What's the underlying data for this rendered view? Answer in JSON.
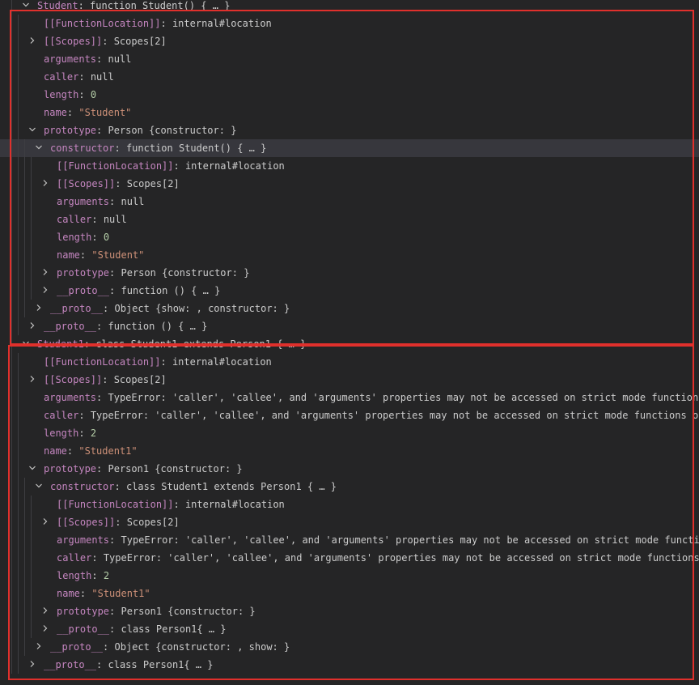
{
  "rows": [
    {
      "depth": 0,
      "expanded": true,
      "key": "Student",
      "val": "function Student() { … }",
      "kind": "fn"
    },
    {
      "depth": 1,
      "expanded": null,
      "key": "[[FunctionLocation]]",
      "val": "internal#location",
      "kind": "fn"
    },
    {
      "depth": 1,
      "expanded": false,
      "key": "[[Scopes]]",
      "val": "Scopes[2]",
      "kind": "fn"
    },
    {
      "depth": 1,
      "expanded": null,
      "key": "arguments",
      "val": "null",
      "kind": "fn"
    },
    {
      "depth": 1,
      "expanded": null,
      "key": "caller",
      "val": "null",
      "kind": "fn"
    },
    {
      "depth": 1,
      "expanded": null,
      "key": "length",
      "val": "0",
      "kind": "num"
    },
    {
      "depth": 1,
      "expanded": null,
      "key": "name",
      "val": "\"Student\"",
      "kind": "str"
    },
    {
      "depth": 1,
      "expanded": true,
      "key": "prototype",
      "val": "Person {constructor: }",
      "kind": "fn"
    },
    {
      "depth": 2,
      "expanded": true,
      "key": "constructor",
      "val": "function Student() { … }",
      "kind": "fn",
      "selected": true
    },
    {
      "depth": 3,
      "expanded": null,
      "key": "[[FunctionLocation]]",
      "val": "internal#location",
      "kind": "fn"
    },
    {
      "depth": 3,
      "expanded": false,
      "key": "[[Scopes]]",
      "val": "Scopes[2]",
      "kind": "fn"
    },
    {
      "depth": 3,
      "expanded": null,
      "key": "arguments",
      "val": "null",
      "kind": "fn"
    },
    {
      "depth": 3,
      "expanded": null,
      "key": "caller",
      "val": "null",
      "kind": "fn"
    },
    {
      "depth": 3,
      "expanded": null,
      "key": "length",
      "val": "0",
      "kind": "num"
    },
    {
      "depth": 3,
      "expanded": null,
      "key": "name",
      "val": "\"Student\"",
      "kind": "str"
    },
    {
      "depth": 3,
      "expanded": false,
      "key": "prototype",
      "val": "Person {constructor: }",
      "kind": "fn"
    },
    {
      "depth": 3,
      "expanded": false,
      "key": "__proto__",
      "val": "function () { … }",
      "kind": "fn"
    },
    {
      "depth": 2,
      "expanded": false,
      "key": "__proto__",
      "val": "Object {show: , constructor: }",
      "kind": "fn"
    },
    {
      "depth": 1,
      "expanded": false,
      "key": "__proto__",
      "val": "function () { … }",
      "kind": "fn"
    },
    {
      "depth": 0,
      "expanded": true,
      "key": "Student1",
      "val": "class Student1 extends Person1 { … }",
      "kind": "fn"
    },
    {
      "depth": 1,
      "expanded": null,
      "key": "[[FunctionLocation]]",
      "val": "internal#location",
      "kind": "fn"
    },
    {
      "depth": 1,
      "expanded": false,
      "key": "[[Scopes]]",
      "val": "Scopes[2]",
      "kind": "fn"
    },
    {
      "depth": 1,
      "expanded": null,
      "key": "arguments",
      "val": "TypeError: 'caller', 'callee', and 'arguments' properties may not be accessed on strict mode functions …",
      "kind": "fn"
    },
    {
      "depth": 1,
      "expanded": null,
      "key": "caller",
      "val": "TypeError: 'caller', 'callee', and 'arguments' properties may not be accessed on strict mode functions or …",
      "kind": "fn"
    },
    {
      "depth": 1,
      "expanded": null,
      "key": "length",
      "val": "2",
      "kind": "num"
    },
    {
      "depth": 1,
      "expanded": null,
      "key": "name",
      "val": "\"Student1\"",
      "kind": "str"
    },
    {
      "depth": 1,
      "expanded": true,
      "key": "prototype",
      "val": "Person1 {constructor: }",
      "kind": "fn"
    },
    {
      "depth": 2,
      "expanded": true,
      "key": "constructor",
      "val": "class Student1 extends Person1 { … }",
      "kind": "fn"
    },
    {
      "depth": 3,
      "expanded": null,
      "key": "[[FunctionLocation]]",
      "val": "internal#location",
      "kind": "fn"
    },
    {
      "depth": 3,
      "expanded": false,
      "key": "[[Scopes]]",
      "val": "Scopes[2]",
      "kind": "fn"
    },
    {
      "depth": 3,
      "expanded": null,
      "key": "arguments",
      "val": "TypeError: 'caller', 'callee', and 'arguments' properties may not be accessed on strict mode function…",
      "kind": "fn"
    },
    {
      "depth": 3,
      "expanded": null,
      "key": "caller",
      "val": "TypeError: 'caller', 'callee', and 'arguments' properties may not be accessed on strict mode functions o…",
      "kind": "fn"
    },
    {
      "depth": 3,
      "expanded": null,
      "key": "length",
      "val": "2",
      "kind": "num"
    },
    {
      "depth": 3,
      "expanded": null,
      "key": "name",
      "val": "\"Student1\"",
      "kind": "str"
    },
    {
      "depth": 3,
      "expanded": false,
      "key": "prototype",
      "val": "Person1 {constructor: }",
      "kind": "fn"
    },
    {
      "depth": 3,
      "expanded": false,
      "key": "__proto__",
      "val": "class Person1{ … }",
      "kind": "fn"
    },
    {
      "depth": 2,
      "expanded": false,
      "key": "__proto__",
      "val": "Object {constructor: , show: }",
      "kind": "fn"
    },
    {
      "depth": 1,
      "expanded": false,
      "key": "__proto__",
      "val": "class Person1{ … }",
      "kind": "fn"
    }
  ],
  "separator": ":",
  "colors": {
    "background": "#252526",
    "key": "#c586c0",
    "value": "#cccccc",
    "number": "#b5cea8",
    "string": "#ce9178",
    "highlight_border": "#e0302c",
    "selected_row": "#37373d"
  },
  "icons": {
    "expanded": "chevron-down-icon",
    "collapsed": "chevron-right-icon"
  }
}
